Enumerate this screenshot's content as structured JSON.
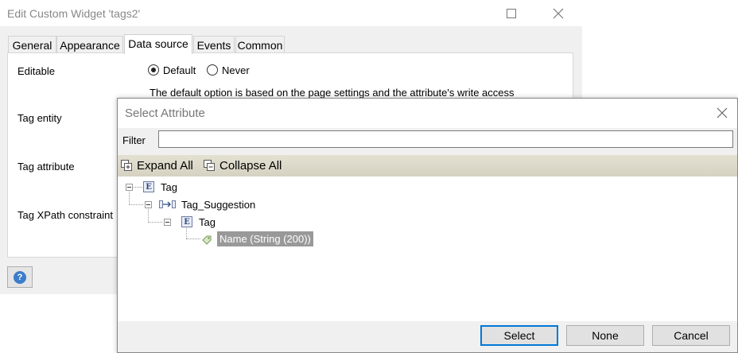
{
  "back_window": {
    "title": "Edit Custom Widget 'tags2'",
    "tabs": [
      {
        "label": "General"
      },
      {
        "label": "Appearance"
      },
      {
        "label": "Data source"
      },
      {
        "label": "Events"
      },
      {
        "label": "Common"
      }
    ],
    "active_tab": "Data source",
    "fields": {
      "editable_label": "Editable",
      "editable_options": [
        "Default",
        "Never"
      ],
      "editable_selected": "Default",
      "editable_help": "The default option is based on the page settings and the attribute's write access",
      "tag_entity_label": "Tag entity",
      "tag_attribute_label": "Tag attribute",
      "tag_xpath_label": "Tag XPath constraint"
    }
  },
  "dialog": {
    "title": "Select Attribute",
    "filter_label": "Filter",
    "filter_value": "",
    "toolbar": {
      "expand_all": "Expand All",
      "collapse_all": "Collapse All"
    },
    "tree": [
      {
        "label": "Tag",
        "icon": "entity-icon",
        "level": 0
      },
      {
        "label": "Tag_Suggestion",
        "icon": "association-icon",
        "level": 1
      },
      {
        "label": "Tag",
        "icon": "entity-icon",
        "level": 2
      },
      {
        "label": "Name (String (200))",
        "icon": "attribute-icon",
        "level": 3,
        "selected": true
      }
    ],
    "buttons": {
      "select": "Select",
      "none": "None",
      "cancel": "Cancel"
    }
  },
  "colors": {
    "selection_bg": "#999999",
    "toolbar_bg": "#dcd8c8",
    "default_button_border": "#0078d7"
  }
}
